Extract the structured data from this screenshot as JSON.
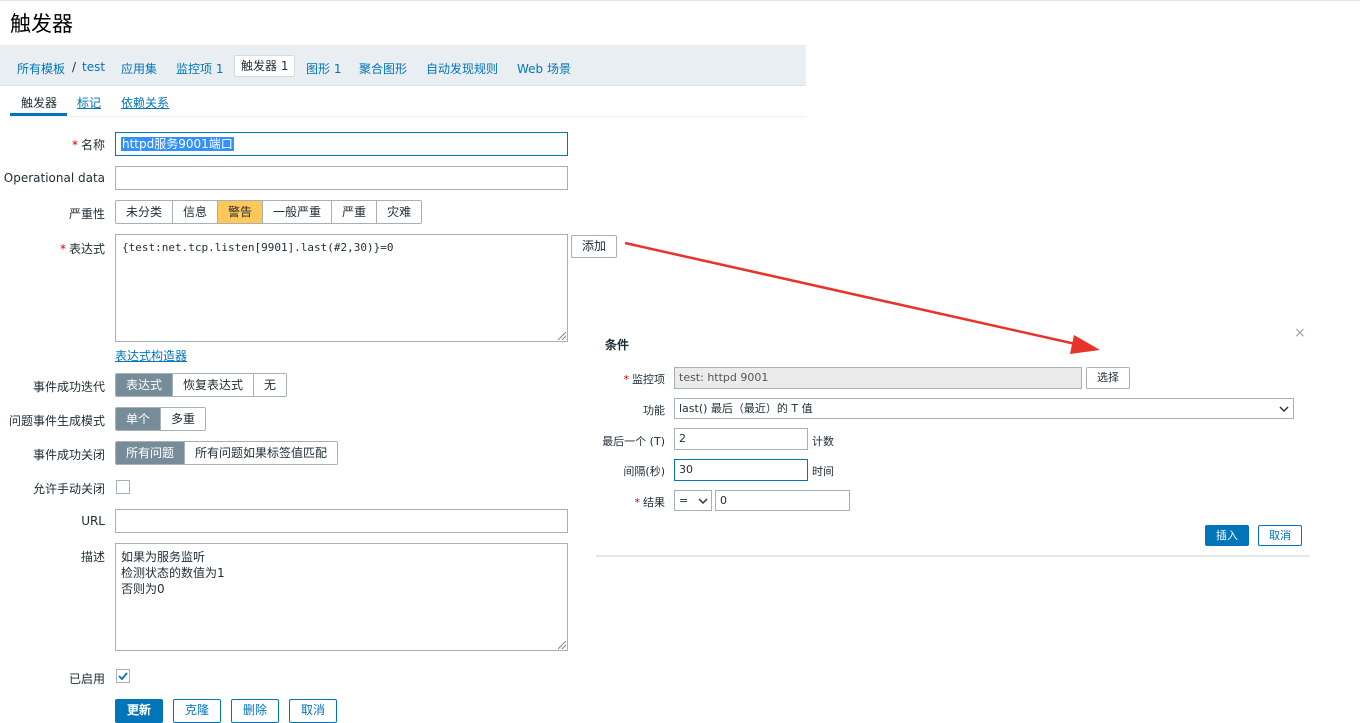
{
  "page": {
    "title": "触发器"
  },
  "nav": {
    "all_templates": "所有模板",
    "sep": "/",
    "host": "test",
    "applications": "应用集",
    "items": "监控项 1",
    "triggers": "触发器 1",
    "graphs": "图形 1",
    "screens": "聚合图形",
    "discovery": "自动发现规则",
    "web": "Web 场景"
  },
  "subtabs": {
    "trigger": "触发器",
    "tags": "标记",
    "dependencies": "依赖关系"
  },
  "form": {
    "name_label": "名称",
    "name_value": "httpd服务9001端口",
    "opdata_label": "Operational data",
    "opdata_value": "",
    "severity_label": "严重性",
    "severity_options": [
      "未分类",
      "信息",
      "警告",
      "一般严重",
      "严重",
      "灾难"
    ],
    "expression_label": "表达式",
    "expression_value": "{test:net.tcp.listen[9901].last(#2,30)}=0",
    "add_button": "添加",
    "expression_builder": "表达式构造器",
    "ok_event_label": "事件成功迭代",
    "ok_event_options": [
      "表达式",
      "恢复表达式",
      "无"
    ],
    "problem_mode_label": "问题事件生成模式",
    "problem_mode_options": [
      "单个",
      "多重"
    ],
    "ok_close_label": "事件成功关闭",
    "ok_close_options": [
      "所有问题",
      "所有问题如果标签值匹配"
    ],
    "manual_close_label": "允许手动关闭",
    "url_label": "URL",
    "url_value": "",
    "description_label": "描述",
    "description_lines": [
      "如果为服务监听",
      "检测状态的数值为1",
      "否则为0"
    ],
    "enabled_label": "已启用",
    "update_button": "更新",
    "clone_button": "克隆",
    "delete_button": "删除",
    "cancel_button": "取消"
  },
  "dialog": {
    "title": "条件",
    "close": "×",
    "item_label": "监控项",
    "item_value": "test: httpd 9001",
    "select_button": "选择",
    "function_label": "功能",
    "function_value": "last()   最后（最近）的 T 值",
    "last_label": "最后一个 (T)",
    "last_value": "2",
    "last_unit": "计数",
    "interval_label": "间隔(秒)",
    "interval_value": "30",
    "interval_unit": "时间",
    "result_label": "结果",
    "result_operator": "=",
    "result_value": "0",
    "insert_button": "插入",
    "cancel_button": "取消"
  },
  "colors": {
    "accent": "#0275b8",
    "warning": "#ffc859",
    "arrow": "#e8332a"
  }
}
